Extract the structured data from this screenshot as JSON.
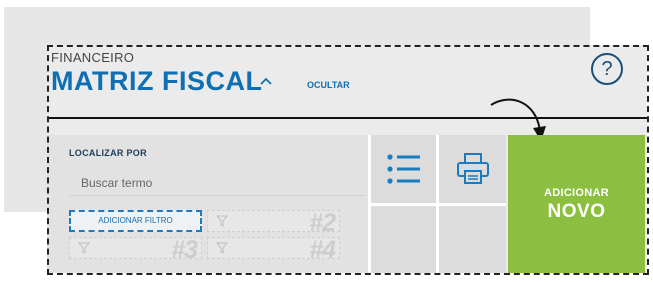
{
  "header": {
    "overline": "FINANCEIRO",
    "title": "MATRIZ FISCAL",
    "hide_label": "OCULTAR",
    "help_symbol": "?"
  },
  "search": {
    "label": "LOCALIZAR POR",
    "placeholder": "Buscar termo",
    "add_filter_label": "ADICIONAR FILTRO",
    "filter_slots": [
      {
        "number": "#2"
      },
      {
        "number": "#3"
      },
      {
        "number": "#4"
      }
    ]
  },
  "tools": {
    "list_icon": "list-icon",
    "print_icon": "printer-icon"
  },
  "add_new": {
    "line1": "ADICIONAR",
    "line2": "NOVO"
  },
  "colors": {
    "brand_blue": "#0f6fb2",
    "add_green": "#8cbf3f",
    "panel_gray": "#ebebeb"
  }
}
